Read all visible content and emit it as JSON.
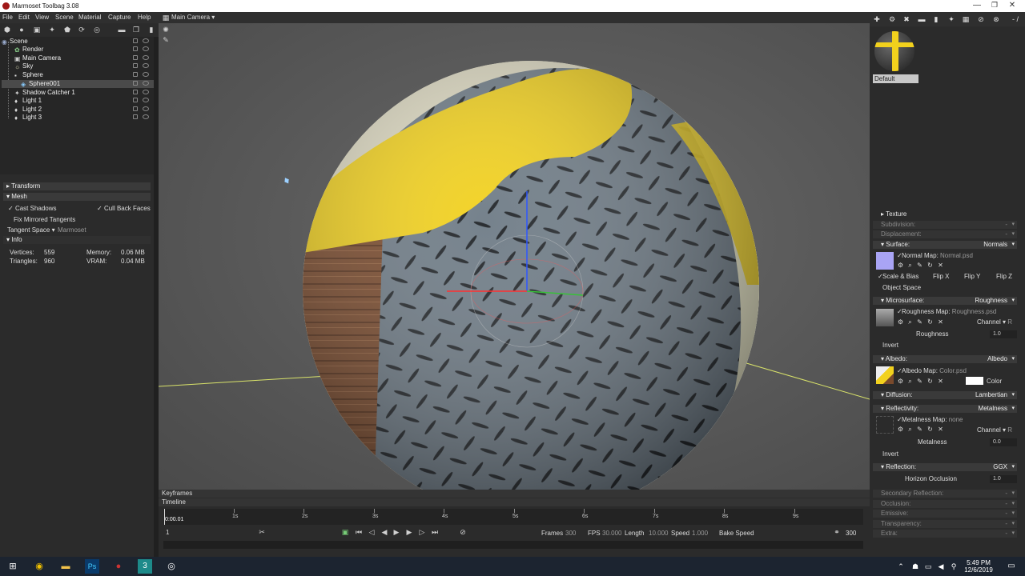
{
  "window": {
    "title": "Marmoset Toolbag 3.08",
    "min": "—",
    "max": "❐",
    "close": "✕"
  },
  "menu": {
    "items": [
      "File",
      "Edit",
      "View",
      "Scene",
      "Material",
      "Capture",
      "Help"
    ]
  },
  "viewport": {
    "camera_menu": "Main Camera ▾"
  },
  "scene_tree": {
    "items": [
      {
        "label": "Scene",
        "indent": 0,
        "icon": "scene-icon"
      },
      {
        "label": "Render",
        "indent": 1,
        "icon": "render-icon"
      },
      {
        "label": "Main Camera",
        "indent": 1,
        "icon": "camera-icon"
      },
      {
        "label": "Sky",
        "indent": 1,
        "icon": "sky-icon"
      },
      {
        "label": "Sphere",
        "indent": 1,
        "icon": "folder-icon"
      },
      {
        "label": "Sphere001",
        "indent": 2,
        "icon": "mesh-icon",
        "selected": true
      },
      {
        "label": "Shadow Catcher 1",
        "indent": 1,
        "icon": "shadow-catcher-icon"
      },
      {
        "label": "Light 1",
        "indent": 1,
        "icon": "light-icon"
      },
      {
        "label": "Light 2",
        "indent": 1,
        "icon": "light-icon"
      },
      {
        "label": "Light 3",
        "indent": 1,
        "icon": "light-icon"
      }
    ]
  },
  "properties": {
    "transform": "Transform",
    "mesh": "Mesh",
    "cast_shadows": "Cast Shadows",
    "cull_back_faces": "Cull Back Faces",
    "fix_mirrored": "Fix Mirrored Tangents",
    "tangent_space_label": "Tangent Space",
    "tangent_space_value": "Marmoset",
    "info": "Info",
    "vertices_label": "Vertices:",
    "vertices_value": "559",
    "triangles_label": "Triangles:",
    "triangles_value": "960",
    "memory_label": "Memory:",
    "memory_value": "0.06 MB",
    "vram_label": "VRAM:",
    "vram_value": "0.04 MB"
  },
  "material": {
    "name": "Default",
    "texture": "Texture",
    "subdivision": "Subdivision:",
    "displacement": "Displacement:",
    "surface": "Surface:",
    "surface_value": "Normals",
    "normal_map_label": "Normal Map:",
    "normal_map_file": "Normal.psd",
    "scale_bias": "Scale & Bias",
    "flip_x": "Flip X",
    "flip_y": "Flip Y",
    "flip_z": "Flip Z",
    "object_space": "Object Space",
    "microsurface": "Microsurface:",
    "microsurface_value": "Roughness",
    "roughness_map_label": "Roughness Map:",
    "roughness_map_file": "Roughness.psd",
    "channel_label": "Channel",
    "channel_value": "R",
    "roughness_label": "Roughness",
    "roughness_value": "1.0",
    "invert": "Invert",
    "albedo": "Albedo:",
    "albedo_value": "Albedo",
    "albedo_map_label": "Albedo Map:",
    "albedo_map_file": "Color.psd",
    "color_label": "Color",
    "diffusion": "Diffusion:",
    "diffusion_value": "Lambertian",
    "reflectivity": "Reflectivity:",
    "reflectivity_value": "Metalness",
    "metalness_map_label": "Metalness Map:",
    "metalness_map_file": "none",
    "metalness_label": "Metalness",
    "metalness_value": "0.0",
    "reflection": "Reflection:",
    "reflection_value": "GGX",
    "horizon_occlusion": "Horizon Occlusion",
    "horizon_value": "1.0",
    "secondary_reflection": "Secondary Reflection:",
    "occlusion": "Occlusion:",
    "emissive": "Emissive:",
    "transparency": "Transparency:",
    "extra": "Extra:",
    "dash": "-",
    "counter": "- /"
  },
  "timeline": {
    "keyframes": "Keyframes",
    "timeline": "Timeline",
    "current_time": "0:00.01",
    "frame_start": "1",
    "ticks": [
      "1s",
      "2s",
      "3s",
      "4s",
      "5s",
      "6s",
      "7s",
      "8s",
      "9s"
    ],
    "frames_label": "Frames",
    "frames_value": "300",
    "fps_label": "FPS",
    "fps_value": "30.000",
    "length_label": "Length",
    "length_value": "10.000",
    "speed_label": "Speed",
    "speed_value": "1.000",
    "bake_speed": "Bake Speed",
    "end_frame": "300"
  },
  "taskbar": {
    "time": "5:49 PM",
    "date": "12/6/2019"
  },
  "colors": {
    "accent_yellow": "#f2d11d",
    "normal_swatch": "#a9a4f5"
  }
}
